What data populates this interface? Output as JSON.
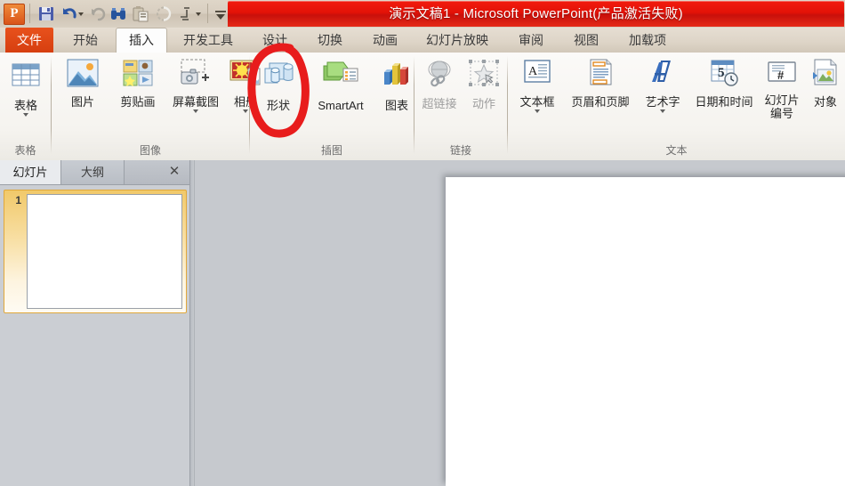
{
  "window": {
    "title": "演示文稿1 - Microsoft PowerPoint(产品激活失败)",
    "title_bar_color": "#e31207",
    "accent_orange": "#e8511c"
  },
  "quick_access": {
    "app_logo_letter": "P",
    "items": [
      {
        "name": "save-icon",
        "label": "保存"
      },
      {
        "name": "undo-icon",
        "label": "撤消"
      },
      {
        "name": "undo-dropdown-caret",
        "label": ""
      },
      {
        "name": "redo-icon",
        "label": "恢复"
      },
      {
        "name": "find-icon",
        "label": "查找"
      },
      {
        "name": "paste-icon",
        "label": "粘贴"
      },
      {
        "name": "refresh-icon",
        "label": "刷新"
      },
      {
        "name": "chart-tool-icon",
        "label": "图表工具"
      },
      {
        "name": "chart-tool-caret",
        "label": ""
      },
      {
        "name": "customize-qat-caret",
        "label": "自定义快速访问工具栏"
      }
    ]
  },
  "tabs": [
    {
      "label": "文件",
      "kind": "file",
      "active": false
    },
    {
      "label": "开始",
      "kind": "normal",
      "active": false
    },
    {
      "label": "插入",
      "kind": "normal",
      "active": true
    },
    {
      "label": "开发工具",
      "kind": "normal",
      "active": false
    },
    {
      "label": "设计",
      "kind": "normal",
      "active": false
    },
    {
      "label": "切换",
      "kind": "normal",
      "active": false
    },
    {
      "label": "动画",
      "kind": "normal",
      "active": false
    },
    {
      "label": "幻灯片放映",
      "kind": "normal",
      "active": false
    },
    {
      "label": "审阅",
      "kind": "normal",
      "active": false
    },
    {
      "label": "视图",
      "kind": "normal",
      "active": false
    },
    {
      "label": "加载项",
      "kind": "normal",
      "active": false
    }
  ],
  "ribbon": {
    "groups": [
      {
        "name": "表格",
        "label": "表格",
        "items": [
          {
            "label": "表格",
            "icon": "table-icon",
            "dropdown": true,
            "disabled": false
          }
        ]
      },
      {
        "name": "图像",
        "label": "图像",
        "items": [
          {
            "label": "图片",
            "icon": "picture-icon",
            "dropdown": false,
            "disabled": false
          },
          {
            "label": "剪贴画",
            "icon": "clipart-icon",
            "dropdown": false,
            "disabled": false
          },
          {
            "label": "屏幕截图",
            "icon": "screenshot-icon",
            "dropdown": true,
            "disabled": false
          },
          {
            "label": "相册",
            "icon": "photo-album-icon",
            "dropdown": true,
            "disabled": false
          }
        ]
      },
      {
        "name": "插图",
        "label": "插图",
        "items": [
          {
            "label": "形状",
            "icon": "shapes-icon",
            "dropdown": false,
            "disabled": false
          },
          {
            "label": "SmartArt",
            "icon": "smartart-icon",
            "dropdown": false,
            "disabled": false
          },
          {
            "label": "图表",
            "icon": "chart-icon",
            "dropdown": false,
            "disabled": false
          }
        ]
      },
      {
        "name": "链接",
        "label": "链接",
        "items": [
          {
            "label": "超链接",
            "icon": "hyperlink-icon",
            "dropdown": false,
            "disabled": true
          },
          {
            "label": "动作",
            "icon": "action-icon",
            "dropdown": false,
            "disabled": true
          }
        ]
      },
      {
        "name": "文本",
        "label": "文本",
        "items": [
          {
            "label": "文本框",
            "icon": "textbox-icon",
            "dropdown": true,
            "disabled": false
          },
          {
            "label": "页眉和页脚",
            "icon": "header-footer-icon",
            "dropdown": false,
            "disabled": false
          },
          {
            "label": "艺术字",
            "icon": "wordart-icon",
            "dropdown": true,
            "disabled": false
          },
          {
            "label": "日期和时间",
            "icon": "date-time-icon",
            "dropdown": false,
            "disabled": false
          },
          {
            "label": "幻灯片编号",
            "icon": "slide-number-icon",
            "dropdown": false,
            "disabled": false
          },
          {
            "label": "对象",
            "icon": "object-icon",
            "dropdown": false,
            "disabled": false
          }
        ]
      }
    ]
  },
  "slide_panel": {
    "tabs": [
      {
        "label": "幻灯片",
        "active": true
      },
      {
        "label": "大纲",
        "active": false
      }
    ],
    "close_glyph": "✕",
    "slides": [
      {
        "number": "1",
        "selected": true
      }
    ]
  },
  "annotation": {
    "name": "red-circle-annotation",
    "color": "#e81c1c",
    "targets": "形状"
  }
}
